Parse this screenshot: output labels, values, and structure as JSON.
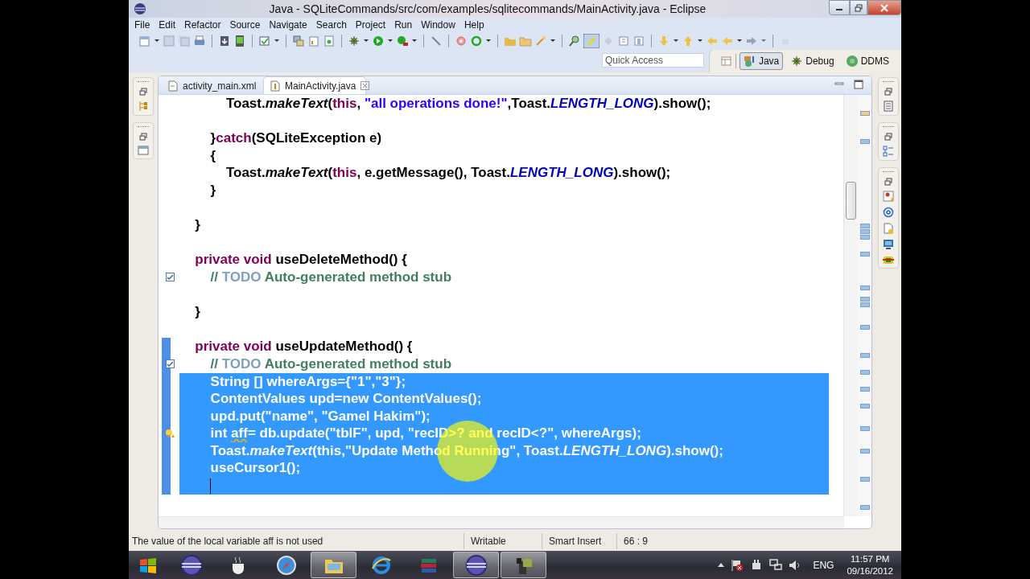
{
  "window": {
    "title": "Java - SQLiteCommands/src/com/examples/sqlitecommands/MainActivity.java - Eclipse"
  },
  "menu": [
    "File",
    "Edit",
    "Refactor",
    "Source",
    "Navigate",
    "Search",
    "Project",
    "Run",
    "Window",
    "Help"
  ],
  "quick_access": {
    "placeholder": "Quick Access"
  },
  "perspectives": [
    {
      "label": "Java",
      "kind": "java",
      "selected": true
    },
    {
      "label": "Debug",
      "kind": "debug",
      "selected": false
    },
    {
      "label": "DDMS",
      "kind": "ddms",
      "selected": false
    }
  ],
  "editor": {
    "tabs": [
      {
        "label": "activity_main.xml",
        "kind": "xml",
        "selected": false
      },
      {
        "label": "MainActivity.java",
        "kind": "java",
        "selected": true
      }
    ],
    "lines": [
      {
        "selected": false,
        "range": false,
        "segments": [
          {
            "kind": "plain",
            "text": "\t\t\tToast."
          },
          {
            "kind": "method",
            "text": "makeText"
          },
          {
            "kind": "plain",
            "text": "("
          },
          {
            "kind": "keyword",
            "text": "this"
          },
          {
            "kind": "plain",
            "text": ", "
          },
          {
            "kind": "string",
            "text": "\"all operations done!\""
          },
          {
            "kind": "plain",
            "text": ",Toast."
          },
          {
            "kind": "constant",
            "text": "LENGTH_LONG"
          },
          {
            "kind": "plain",
            "text": ").show();"
          }
        ]
      },
      {
        "selected": false,
        "range": false
      },
      {
        "selected": false,
        "range": false,
        "segments": [
          {
            "kind": "plain",
            "text": "\t\t}"
          },
          {
            "kind": "keyword",
            "text": "catch"
          },
          {
            "kind": "plain",
            "text": "(SQLiteException e)"
          }
        ]
      },
      {
        "selected": false,
        "range": false,
        "segments": [
          {
            "kind": "plain",
            "text": "\t\t{"
          }
        ]
      },
      {
        "selected": false,
        "range": false,
        "segments": [
          {
            "kind": "plain",
            "text": "\t\t\tToast."
          },
          {
            "kind": "method",
            "text": "makeText"
          },
          {
            "kind": "plain",
            "text": "("
          },
          {
            "kind": "keyword",
            "text": "this"
          },
          {
            "kind": "plain",
            "text": ", e.getMessage(), Toast."
          },
          {
            "kind": "constant",
            "text": "LENGTH_LONG"
          },
          {
            "kind": "plain",
            "text": ").show();"
          }
        ]
      },
      {
        "selected": false,
        "range": false,
        "segments": [
          {
            "kind": "plain",
            "text": "\t\t}"
          }
        ]
      },
      {
        "selected": false,
        "range": false
      },
      {
        "selected": false,
        "range": false,
        "segments": [
          {
            "kind": "plain",
            "text": "\t}"
          }
        ]
      },
      {
        "selected": false,
        "range": false
      },
      {
        "selected": false,
        "range": false,
        "segments": [
          {
            "kind": "keyword",
            "text": "\tprivate void"
          },
          {
            "kind": "plain",
            "text": " useDeleteMethod() {"
          }
        ]
      },
      {
        "selected": false,
        "range": false,
        "task": true,
        "segments": [
          {
            "kind": "comment",
            "text": "\t\t// "
          },
          {
            "kind": "todo",
            "text": "TODO"
          },
          {
            "kind": "comment",
            "text": " Auto-generated method stub"
          }
        ]
      },
      {
        "selected": false,
        "range": false
      },
      {
        "selected": false,
        "range": false,
        "segments": [
          {
            "kind": "plain",
            "text": "\t}"
          }
        ]
      },
      {
        "selected": false,
        "range": false
      },
      {
        "selected": false,
        "range": true,
        "segments": [
          {
            "kind": "keyword",
            "text": "\tprivate void"
          },
          {
            "kind": "plain",
            "text": " useUpdateMethod() {"
          }
        ]
      },
      {
        "selected": false,
        "range": true,
        "task": true,
        "segments": [
          {
            "kind": "comment",
            "text": "\t\t// "
          },
          {
            "kind": "todo",
            "text": "TODO"
          },
          {
            "kind": "comment",
            "text": " Auto-generated method stub"
          }
        ]
      },
      {
        "selected": true,
        "range": true,
        "segments": [
          {
            "kind": "plain",
            "text": "\t\tString [] whereArgs={"
          },
          {
            "kind": "string",
            "text": "\"1\""
          },
          {
            "kind": "plain",
            "text": ","
          },
          {
            "kind": "string",
            "text": "\"3\""
          },
          {
            "kind": "plain",
            "text": "};"
          }
        ]
      },
      {
        "selected": true,
        "range": true,
        "segments": [
          {
            "kind": "plain",
            "text": "\t\tContentValues upd="
          },
          {
            "kind": "keyword",
            "text": "new"
          },
          {
            "kind": "plain",
            "text": " ContentValues();"
          }
        ]
      },
      {
        "selected": true,
        "range": true,
        "segments": [
          {
            "kind": "plain",
            "text": "\t\tupd.put("
          },
          {
            "kind": "string",
            "text": "\"name\""
          },
          {
            "kind": "plain",
            "text": ", "
          },
          {
            "kind": "string",
            "text": "\"Gamel Hakim\""
          },
          {
            "kind": "plain",
            "text": ");"
          }
        ]
      },
      {
        "selected": true,
        "range": true,
        "warning": true,
        "segments": [
          {
            "kind": "keyword",
            "text": "\t\tint "
          },
          {
            "kind": "warning",
            "text": "aff"
          },
          {
            "kind": "plain",
            "text": "= db.update("
          },
          {
            "kind": "string",
            "text": "\"tblF\""
          },
          {
            "kind": "plain",
            "text": ", upd, "
          },
          {
            "kind": "string",
            "text": "\"recID>? and recID<?\""
          },
          {
            "kind": "plain",
            "text": ", whereArgs);"
          }
        ]
      },
      {
        "selected": true,
        "range": true,
        "segments": [
          {
            "kind": "plain",
            "text": "\t\tToast."
          },
          {
            "kind": "method",
            "text": "makeText"
          },
          {
            "kind": "plain",
            "text": "("
          },
          {
            "kind": "keyword",
            "text": "this"
          },
          {
            "kind": "plain",
            "text": ","
          },
          {
            "kind": "string",
            "text": "\"Update Method Running\""
          },
          {
            "kind": "plain",
            "text": ", Toast."
          },
          {
            "kind": "constant",
            "text": "LENGTH_LONG"
          },
          {
            "kind": "plain",
            "text": ").show();"
          }
        ]
      },
      {
        "selected": true,
        "range": true,
        "segments": [
          {
            "kind": "plain",
            "text": "\t\tuseCursor1();"
          }
        ]
      },
      {
        "selected": true,
        "range": true,
        "caret": true
      }
    ]
  },
  "status_bar": {
    "message": "The value of the local variable aff is not used",
    "mode": "Writable",
    "insert_mode": "Smart Insert",
    "position": "66 : 9"
  },
  "taskbar": {
    "apps": [
      {
        "kind": "eclipse",
        "selected": false
      },
      {
        "kind": "java",
        "selected": false
      },
      {
        "kind": "safari",
        "selected": false
      },
      {
        "kind": "folder",
        "selected": true
      },
      {
        "kind": "ie",
        "selected": false
      },
      {
        "kind": "books",
        "selected": false
      },
      {
        "kind": "eclipse",
        "selected": true
      },
      {
        "kind": "camera",
        "selected": true
      }
    ],
    "language": "ENG",
    "time": "11:57 PM",
    "date": "09/16/2012"
  }
}
